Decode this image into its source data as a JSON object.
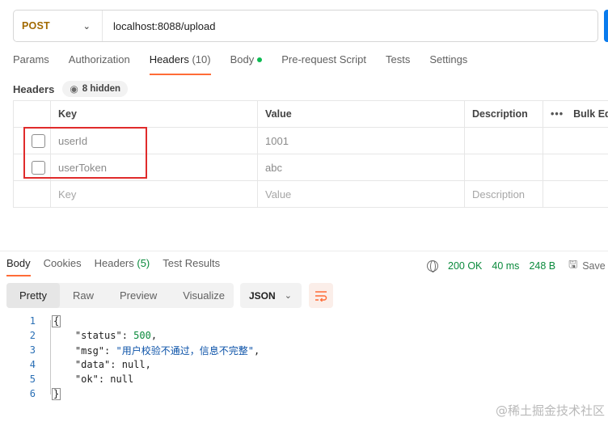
{
  "request": {
    "method": "POST",
    "url": "localhost:8088/upload"
  },
  "request_tabs": [
    {
      "label": "Params"
    },
    {
      "label": "Authorization"
    },
    {
      "label": "Headers",
      "count": "(10)",
      "active": true
    },
    {
      "label": "Body",
      "indicator": "green-dot"
    },
    {
      "label": "Pre-request Script"
    },
    {
      "label": "Tests"
    },
    {
      "label": "Settings"
    }
  ],
  "headers_section": {
    "title": "Headers",
    "hidden_count_label": "8 hidden",
    "columns": {
      "key": "Key",
      "value": "Value",
      "description": "Description",
      "bulk_edit": "Bulk Edi"
    },
    "rows": [
      {
        "key": "userId",
        "value": "1001",
        "description": "",
        "checked": false
      },
      {
        "key": "userToken",
        "value": "abc",
        "description": "",
        "checked": false
      }
    ],
    "new_row_placeholders": {
      "key": "Key",
      "value": "Value",
      "description": "Description"
    },
    "highlight_color": "#e02b2b"
  },
  "response_tabs": [
    {
      "label": "Body",
      "active": true
    },
    {
      "label": "Cookies"
    },
    {
      "label": "Headers",
      "count": "(5)"
    },
    {
      "label": "Test Results"
    }
  ],
  "response_status": {
    "status": "200 OK",
    "time": "40 ms",
    "size": "248 B",
    "save_label": "Save a",
    "status_color": "#0a8a3c"
  },
  "format": {
    "options": [
      "Pretty",
      "Raw",
      "Preview",
      "Visualize"
    ],
    "active": "Pretty",
    "language": "JSON"
  },
  "code_lines": [
    {
      "n": "1"
    },
    {
      "n": "2",
      "key": "\"status\"",
      "value": "500",
      "type": "num",
      "comma": ","
    },
    {
      "n": "3",
      "key": "\"msg\"",
      "value": "\"用户校验不通过，信息不完整\"",
      "type": "str",
      "comma": ","
    },
    {
      "n": "4",
      "key": "\"data\"",
      "value": "null",
      "type": "nul",
      "comma": ","
    },
    {
      "n": "5",
      "key": "\"ok\"",
      "value": "null",
      "type": "nul",
      "comma": ""
    },
    {
      "n": "6"
    }
  ],
  "code": {
    "open": "{",
    "close": "}"
  },
  "watermark": "@稀土掘金技术社区",
  "colors": {
    "accent": "#ff6c37",
    "send_button": "#097bed",
    "method": "#a16900"
  }
}
